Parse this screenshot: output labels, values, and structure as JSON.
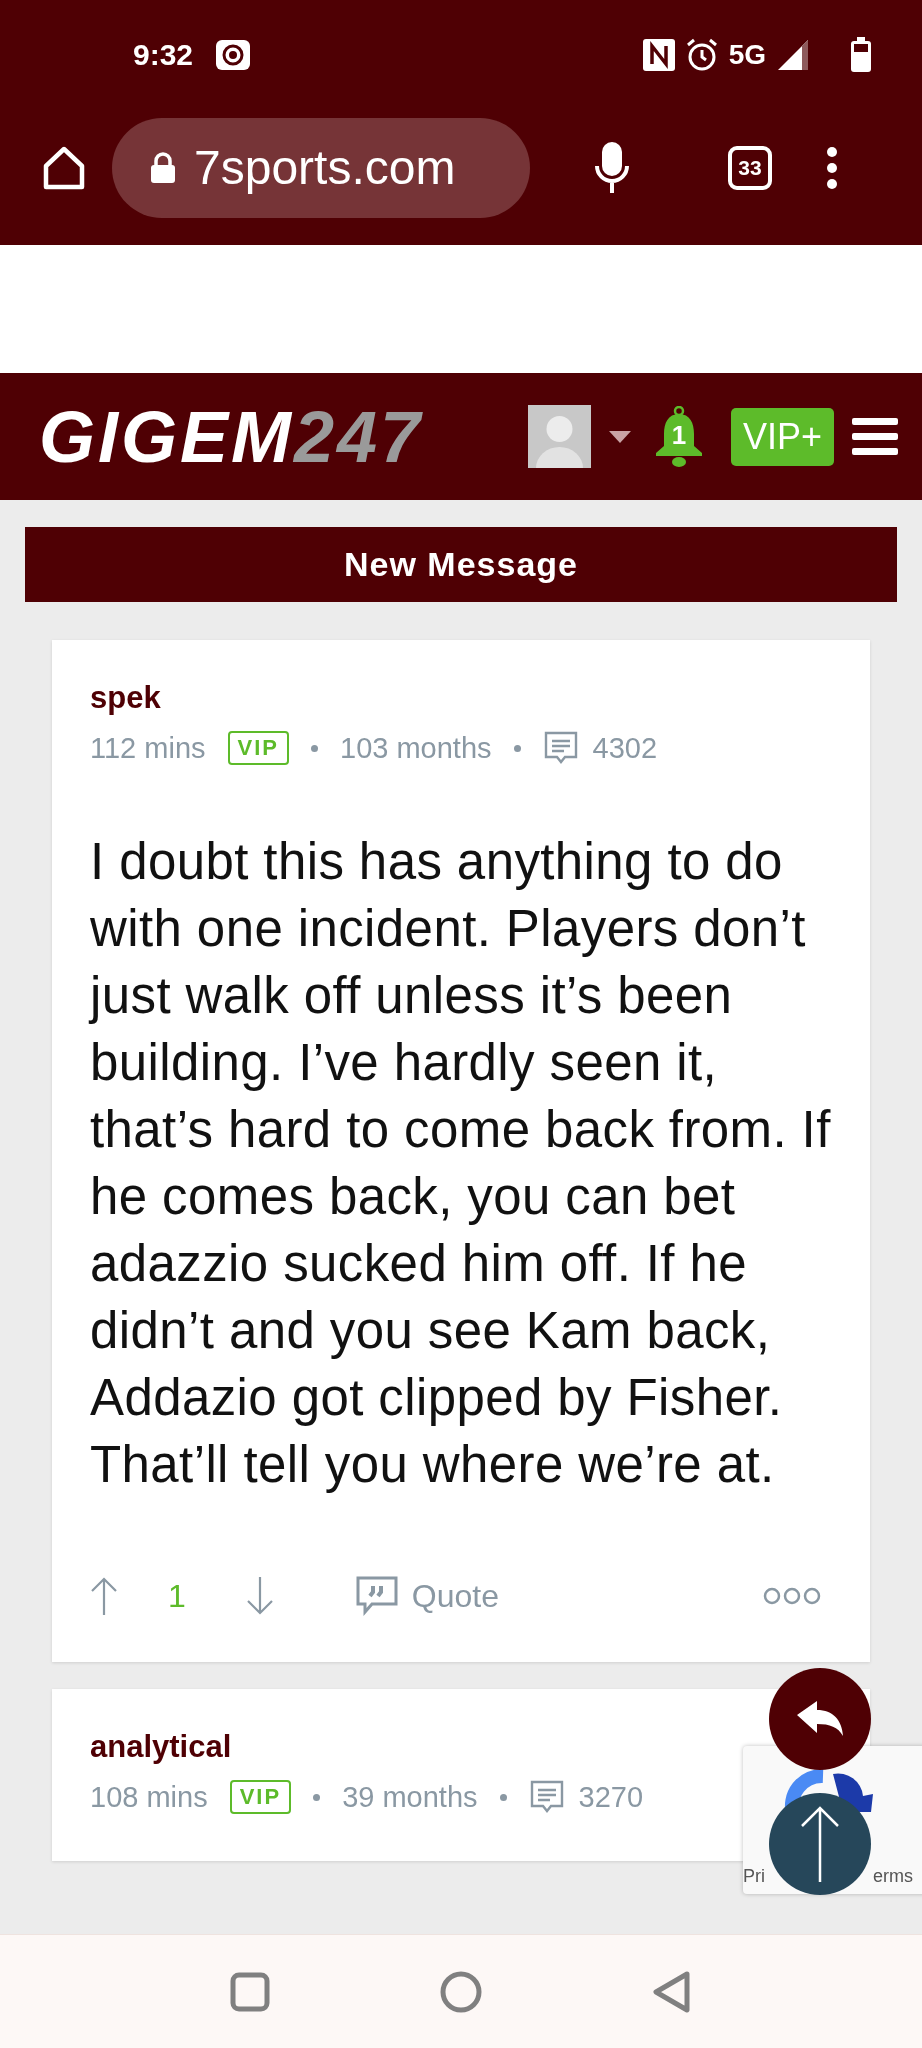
{
  "status_bar": {
    "time": "9:32",
    "network": "5G"
  },
  "browser": {
    "url": "7sports.com",
    "tab_count": "33"
  },
  "site_header": {
    "logo_main": "GIGEM",
    "logo_accent": "247",
    "notification_count": "1",
    "vip_label": "VIP+"
  },
  "section_title": "New Message",
  "posts": [
    {
      "author": "spek",
      "time": "112 mins",
      "badge": "VIP",
      "tenure": "103 months",
      "post_count": "4302",
      "body": "I doubt this has anything to do with one incident. Players don’t just walk off unless it’s been building. I’ve hardly seen it, that’s hard to come back from. If he comes back, you can bet adazzio sucked him off. If he didn’t and you see Kam back, Addazio got clipped by Fisher. That’ll tell you where we’re at.",
      "votes": "1",
      "quote_label": "Quote"
    },
    {
      "author": "analytical",
      "time": "108 mins",
      "badge": "VIP",
      "tenure": "39 months",
      "post_count": "3270"
    }
  ],
  "recaptcha": {
    "left_text": "Pri",
    "right_text": "erms"
  }
}
